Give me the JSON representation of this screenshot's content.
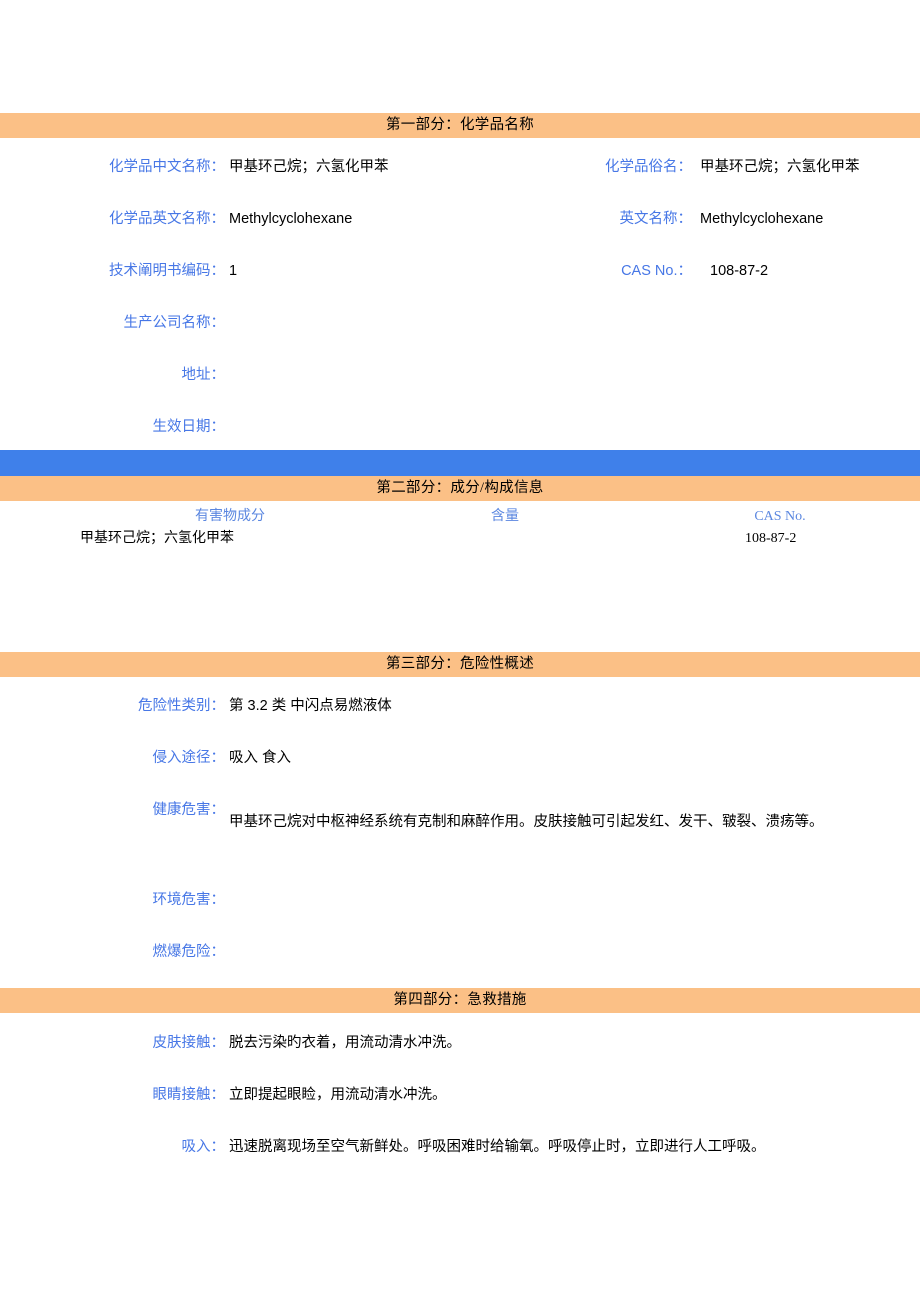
{
  "colors": {
    "section_bar": "#FBC086",
    "divider_bar": "#3F80EA",
    "label_blue": "#4777E6",
    "table_header_blue": "#5B87E0",
    "value_black": "#000000"
  },
  "sections": {
    "one": {
      "title": "第一部分：化学品名称",
      "fields": {
        "cn_name_label": "化学品中文名称：",
        "cn_name_value": "甲基环己烷；六氢化甲苯",
        "common_name_label": "化学品俗名：",
        "common_name_value": "甲基环己烷；六氢化甲苯",
        "en_name_label": "化学品英文名称：",
        "en_name_value": "Methylcyclohexane",
        "en_name_short_label": "英文名称：",
        "en_name_short_value": "Methylcyclohexane",
        "doc_code_label": "技术阐明书编码：",
        "doc_code_value": "1",
        "cas_label": "CAS No.：",
        "cas_value": "108-87-2",
        "company_label": "生产公司名称：",
        "company_value": "",
        "address_label": "地址：",
        "address_value": "",
        "effective_date_label": "生效日期：",
        "effective_date_value": ""
      }
    },
    "two": {
      "title": "第二部分：成分/构成信息",
      "table": {
        "headers": [
          "有害物成分",
          "含量",
          "CAS No."
        ],
        "rows": [
          [
            "甲基环己烷；六氢化甲苯",
            "",
            "108-87-2"
          ]
        ]
      }
    },
    "three": {
      "title": "第三部分：危险性概述",
      "fields": {
        "hazard_class_label": "危险性类别：",
        "hazard_class_value": "第 3.2 类 中闪点易燃液体",
        "invasion_route_label": "侵入途径：",
        "invasion_route_value": "吸入 食入",
        "health_hazard_label": "健康危害：",
        "health_hazard_value": "甲基环己烷对中枢神经系统有克制和麻醉作用。皮肤接触可引起发红、发干、皲裂、溃疡等。",
        "env_hazard_label": "环境危害：",
        "env_hazard_value": "",
        "explosion_hazard_label": "燃爆危险：",
        "explosion_hazard_value": ""
      }
    },
    "four": {
      "title": "第四部分：急救措施",
      "fields": {
        "skin_contact_label": "皮肤接触：",
        "skin_contact_value": "脱去污染旳衣着，用流动清水冲洗。",
        "eye_contact_label": "眼睛接触：",
        "eye_contact_value": "立即提起眼睑，用流动清水冲洗。",
        "inhalation_label": "吸入：",
        "inhalation_value": "迅速脱离现场至空气新鲜处。呼吸困难时给输氧。呼吸停止时，立即进行人工呼吸。"
      }
    }
  }
}
